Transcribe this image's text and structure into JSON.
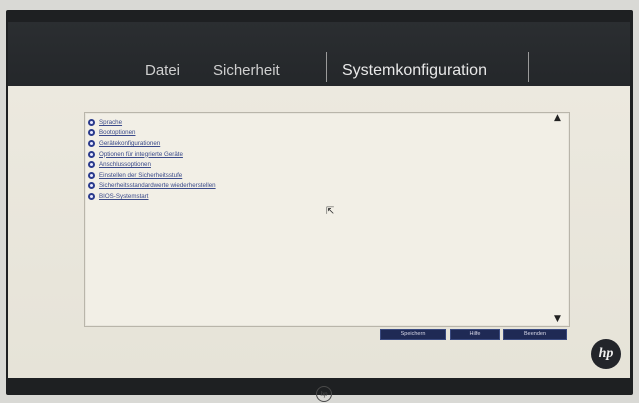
{
  "menu": {
    "tabs": [
      {
        "label": "Datei"
      },
      {
        "label": "Sicherheit"
      },
      {
        "label": "Systemkonfiguration"
      }
    ]
  },
  "items": [
    {
      "label": "Sprache"
    },
    {
      "label": "Bootoptionen"
    },
    {
      "label": "Gerätekonfigurationen"
    },
    {
      "label": "Optionen für integrierte Geräte"
    },
    {
      "label": "Anschlussoptionen"
    },
    {
      "label": "Einstellen der Sicherheitsstufe"
    },
    {
      "label": "Sicherheitsstandardwerte wiederherstellen"
    },
    {
      "label": "BIOS-Systemstart"
    }
  ],
  "buttons": {
    "save": "Speichern",
    "help": "Hilfe",
    "exit": "Beenden"
  },
  "branding": {
    "logo": "hp"
  },
  "icons": {
    "bullet": "circle-arrow-icon",
    "scroll_up": "triangle-up-icon",
    "scroll_down": "triangle-down-icon",
    "cursor": "mouse-pointer-icon"
  },
  "colors": {
    "menu_bg": "#24272a",
    "content_bg": "#ece9df",
    "link": "#3a4a8a",
    "button_bg": "#1f2a55"
  }
}
